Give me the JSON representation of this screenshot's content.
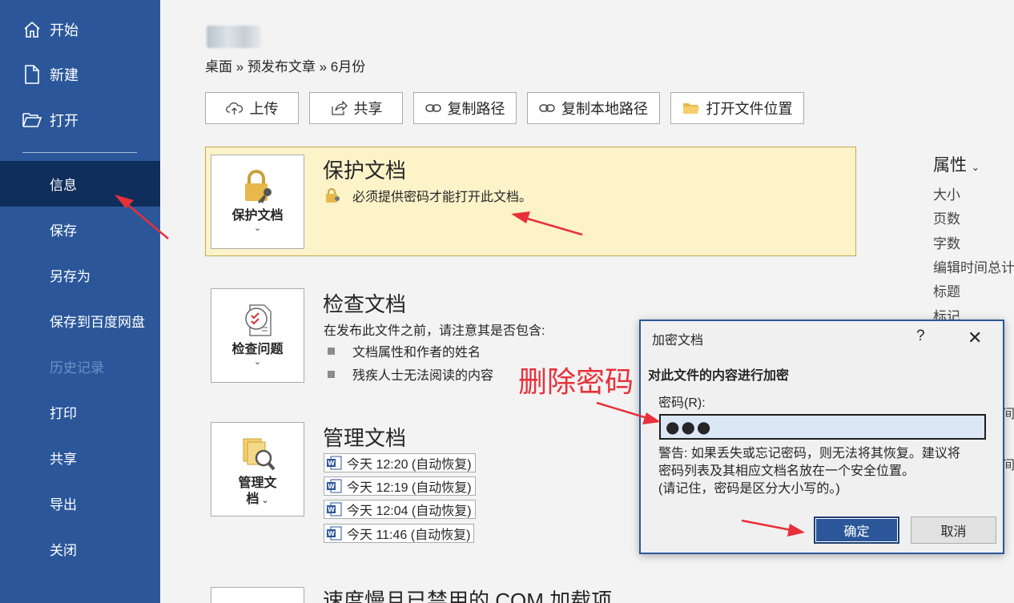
{
  "sidebar": {
    "top_items": [
      {
        "label": "开始",
        "icon": "home-icon"
      },
      {
        "label": "新建",
        "icon": "new-document-icon"
      },
      {
        "label": "打开",
        "icon": "open-folder-icon"
      }
    ],
    "items": [
      {
        "label": "信息",
        "state": "active"
      },
      {
        "label": "保存"
      },
      {
        "label": "另存为"
      },
      {
        "label": "保存到百度网盘"
      },
      {
        "label": "历史记录",
        "state": "disabled"
      },
      {
        "label": "打印"
      },
      {
        "label": "共享"
      },
      {
        "label": "导出"
      },
      {
        "label": "关闭"
      }
    ]
  },
  "header": {
    "breadcrumb": "桌面 » 预发布文章 » 6月份"
  },
  "toolbar": {
    "upload": "上传",
    "share": "共享",
    "copy_path": "复制路径",
    "copy_local_path": "复制本地路径",
    "open_location": "打开文件位置"
  },
  "protect": {
    "button_label": "保护文档",
    "title": "保护文档",
    "message": "必须提供密码才能打开此文档。"
  },
  "inspect": {
    "button_label": "检查问题",
    "title": "检查文档",
    "intro": "在发布此文件之前，请注意其是否包含:",
    "bullets": [
      "文档属性和作者的姓名",
      "残疾人士无法阅读的内容"
    ]
  },
  "manage": {
    "button_label_line1": "管理文",
    "button_label_line2": "档",
    "title": "管理文档",
    "versions": [
      "今天 12:20 (自动恢复)",
      "今天 12:19 (自动恢复)",
      "今天 12:04 (自动恢复)",
      "今天 11:46 (自动恢复)"
    ]
  },
  "bottom_section_title": "速度慢且已禁用的 COM 加载项",
  "properties": {
    "title": "属性",
    "items": [
      "大小",
      "页数",
      "字数",
      "编辑时间总计",
      "标题",
      "标记"
    ],
    "edge_fragments": [
      "间",
      "间"
    ]
  },
  "dialog": {
    "title": "加密文档",
    "help": "?",
    "close": "✕",
    "heading": "对此文件的内容进行加密",
    "label": "密码(R):",
    "password_value": "●●●",
    "warning_line1": "警告: 如果丢失或忘记密码，则无法将其恢复。建议将",
    "warning_line2": "密码列表及其相应文档名放在一个安全位置。",
    "warning_line3": "(请记住，密码是区分大小写的。)",
    "ok": "确定",
    "cancel": "取消"
  },
  "annotation": {
    "text": "删除密码",
    "color": "#e8303a"
  },
  "colors": {
    "sidebar": "#2b579a",
    "sidebar_active": "#0f2e5b",
    "protect_panel": "#fcf3c9"
  }
}
